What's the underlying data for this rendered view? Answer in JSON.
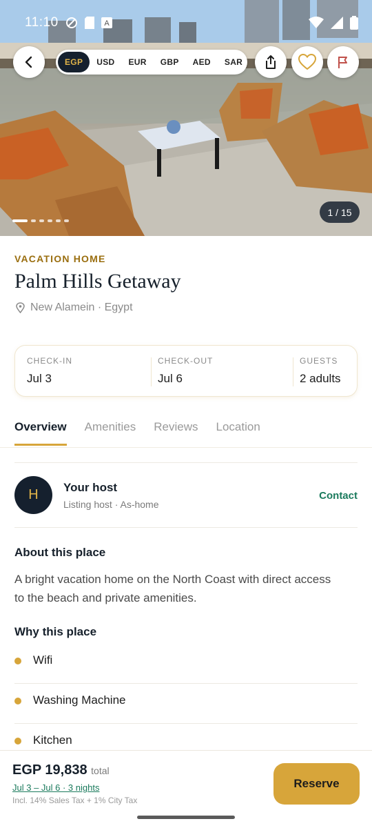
{
  "status_bar": {
    "time": "11:10"
  },
  "gallery": {
    "currencies": [
      "EGP",
      "USD",
      "EUR",
      "GBP",
      "AED",
      "SAR"
    ],
    "selected_currency": "EGP",
    "counter": "1 / 15",
    "current_index": 1,
    "total_images": 15
  },
  "listing": {
    "category": "VACATION HOME",
    "title": "Palm Hills Getaway",
    "location": "New Alamein · Egypt"
  },
  "booking": {
    "checkin_label": "CHECK-IN",
    "checkin_value": "Jul 3",
    "checkout_label": "CHECK-OUT",
    "checkout_value": "Jul 6",
    "guests_label": "GUESTS",
    "guests_value": "2 adults"
  },
  "tabs": [
    "Overview",
    "Amenities",
    "Reviews",
    "Location"
  ],
  "host": {
    "initial": "H",
    "title": "Your host",
    "subtitle": "Listing host · As-home",
    "contact_label": "Contact"
  },
  "about": {
    "heading": "About this place",
    "text": "A bright vacation home on the North Coast with direct access to the beach and private amenities."
  },
  "why": {
    "heading": "Why this place",
    "features": [
      "Wifi",
      "Washing Machine",
      "Kitchen"
    ]
  },
  "footer": {
    "price": "EGP 19,838",
    "price_suffix": "total",
    "dates": "Jul 3 – Jul 6 · 3 nights",
    "tax_note": "Incl. 14% Sales Tax + 1% City Tax",
    "reserve_label": "Reserve"
  },
  "colors": {
    "accent": "#d7a53a",
    "navy": "#15202e",
    "green": "#1a7a5c"
  }
}
